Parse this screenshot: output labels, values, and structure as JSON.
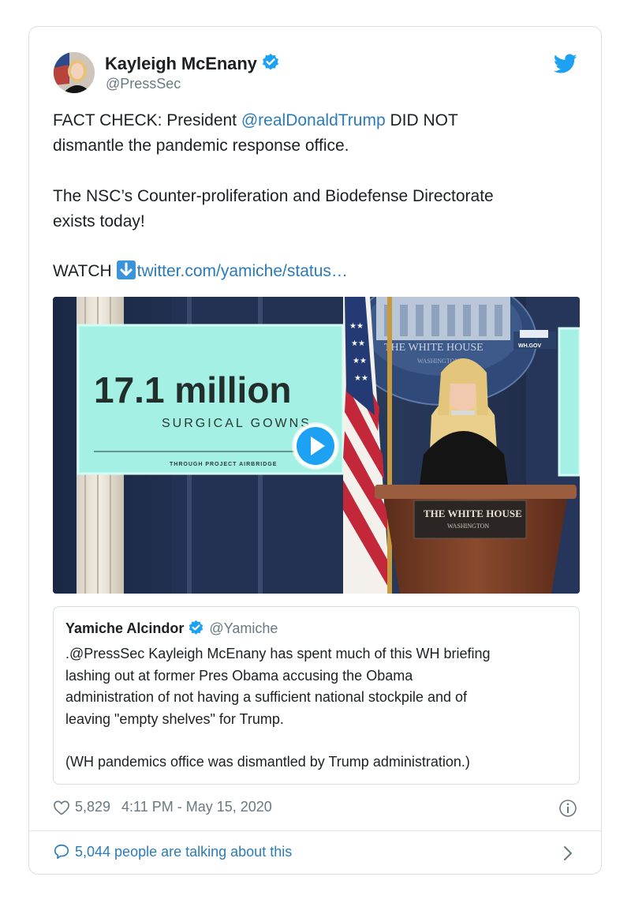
{
  "author": {
    "name": "Kayleigh McEnany",
    "handle": "@PressSec"
  },
  "tweet": {
    "line1_prefix": "FACT CHECK: President ",
    "line1_mention": "@realDonaldTrump",
    "line1_suffix": " DID NOT",
    "line2": "dismantle the pandemic response office.",
    "line3": "The NSC’s Counter-proliferation and Biodefense Directorate",
    "line4": "exists today!",
    "watch_label": "WATCH",
    "watch_link": "twitter.com/yamiche/status…"
  },
  "media": {
    "screen_number": "17.1 million",
    "screen_subtitle": "SURGICAL GOWNS",
    "screen_footnote": "THROUGH PROJECT AIRBRIDGE",
    "seal_text": "THE WHITE HOUSE",
    "seal_sub": "WASHINGTON",
    "wh_gov": "WH.GOV",
    "podium_title": "THE WHITE HOUSE",
    "podium_sub": "WASHINGTON"
  },
  "quoted": {
    "name": "Yamiche Alcindor",
    "handle": "@Yamiche",
    "line1": ".@PressSec Kayleigh McEnany has spent much of this WH briefing",
    "line2": "lashing out at former Pres Obama accusing the Obama",
    "line3": "administration of not having a sufficient national stockpile and of",
    "line4": "leaving \"empty shelves\" for Trump.",
    "line5": "(WH pandemics office was dismantled by Trump administration.)"
  },
  "meta": {
    "likes": "5,829",
    "timestamp": "4:11 PM - May 15, 2020"
  },
  "footer": {
    "talking": "5,044 people are talking about this"
  },
  "colors": {
    "link": "#2b7bb9",
    "twitter_blue": "#1da1f2",
    "muted": "#697882",
    "screen_teal": "#9ff0e4"
  }
}
